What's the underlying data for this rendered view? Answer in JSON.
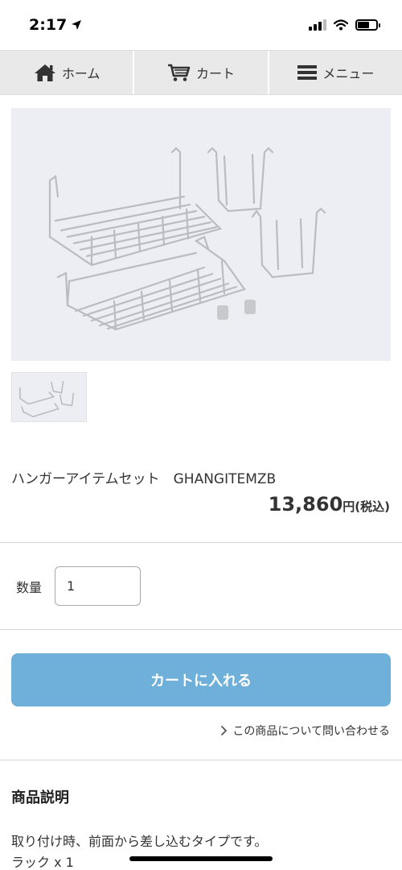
{
  "status_bar": {
    "time": "2:17"
  },
  "nav": {
    "items": [
      {
        "label": "ホーム",
        "icon": "home-icon"
      },
      {
        "label": "カート",
        "icon": "cart-icon"
      },
      {
        "label": "メニュー",
        "icon": "menu-icon"
      }
    ]
  },
  "product": {
    "name": "ハンガーアイテムセット　GHANGITEMZB",
    "price": "13,860",
    "price_unit": "円(税込)"
  },
  "quantity": {
    "label": "数量",
    "value": "1"
  },
  "cart": {
    "button_label": "カートに入れる"
  },
  "inquiry": {
    "label": "この商品について問い合わせる"
  },
  "description": {
    "title": "商品説明",
    "line1": "取り付け時、前面から差し込むタイプです。",
    "line2": "ラック x 1"
  },
  "colors": {
    "accent": "#6fb0da",
    "nav_bg": "#e9e9e9"
  }
}
